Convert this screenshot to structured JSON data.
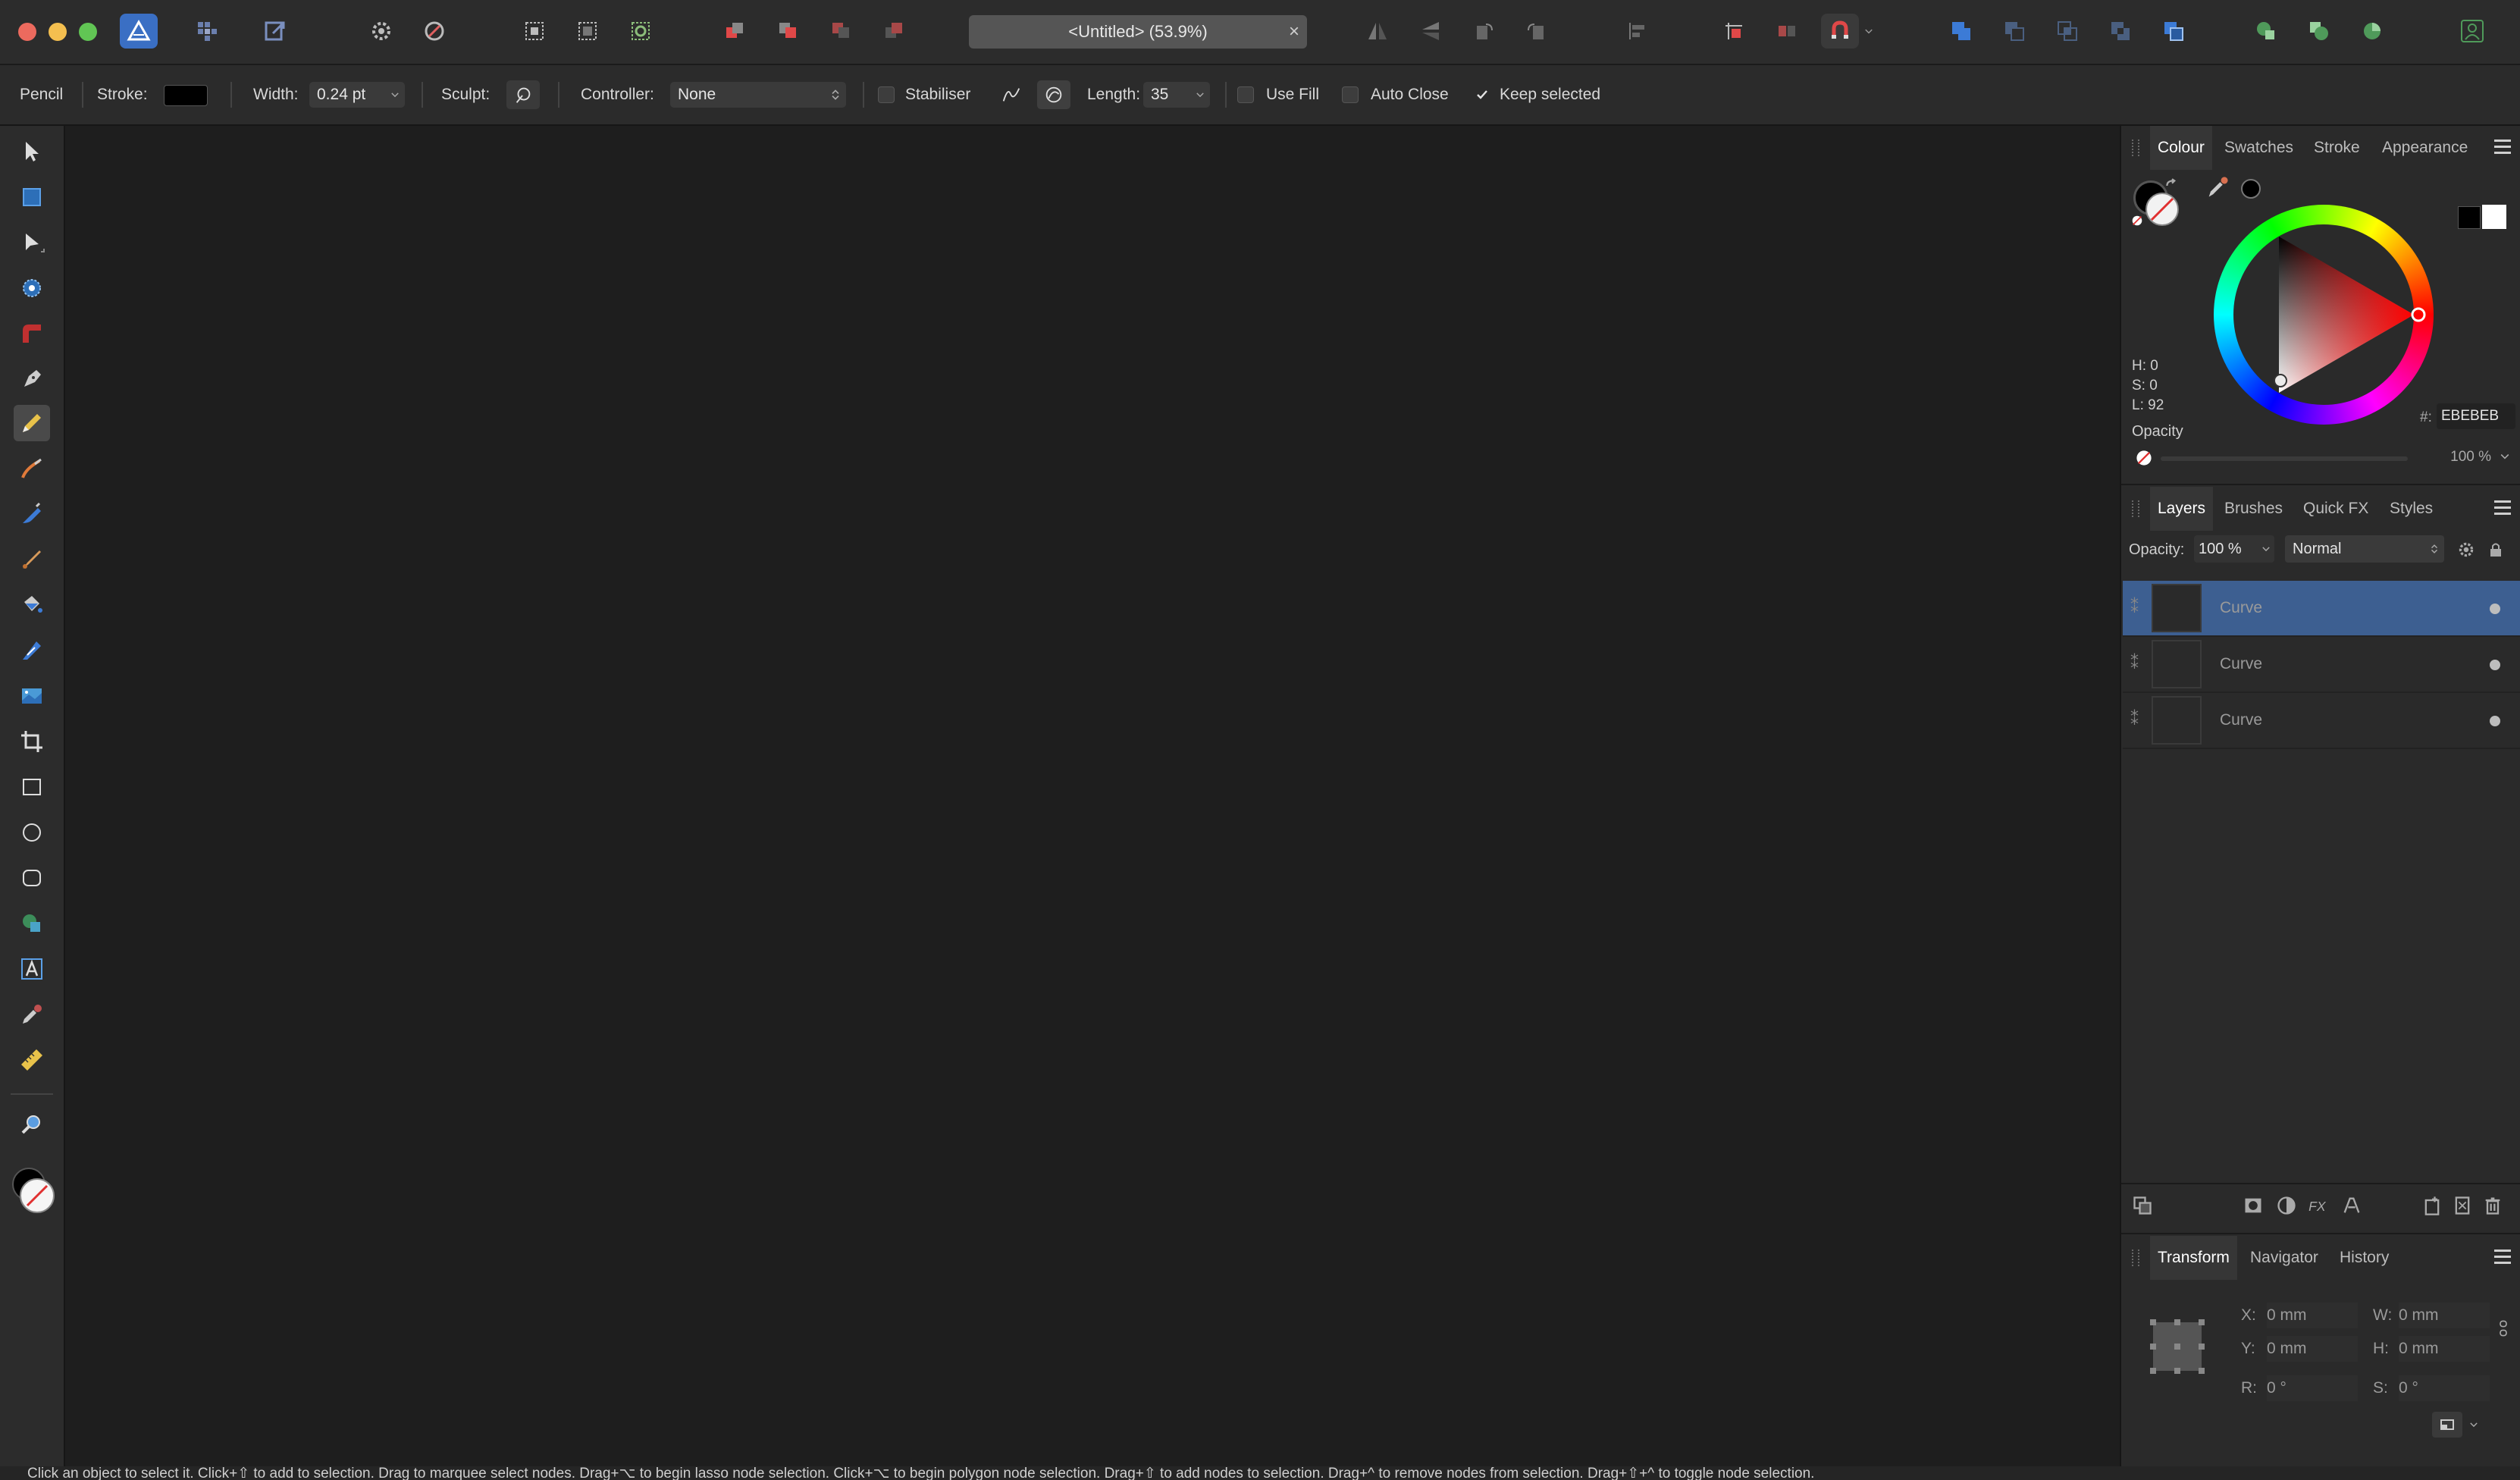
{
  "window": {
    "document_tab": "<Untitled> (53.9%)",
    "close_glyph": "×"
  },
  "context_toolbar": {
    "tool_name": "Pencil",
    "stroke_label": "Stroke:",
    "stroke_color": "#000000",
    "width_label": "Width:",
    "width_value": "0.24 pt",
    "sculpt_label": "Sculpt:",
    "controller_label": "Controller:",
    "controller_value": "None",
    "stabiliser_label": "Stabiliser",
    "length_label": "Length:",
    "length_value": "35",
    "use_fill_label": "Use Fill",
    "auto_close_label": "Auto Close",
    "keep_selected_label": "Keep selected",
    "keep_selected_checked": true
  },
  "colour_panel": {
    "tabs": [
      "Colour",
      "Swatches",
      "Stroke",
      "Appearance"
    ],
    "active_tab": "Colour",
    "h_label": "H: 0",
    "s_label": "S: 0",
    "l_label": "L: 92",
    "hex_prefix": "#:",
    "hex_value": "EBEBEB",
    "opacity_label": "Opacity",
    "opacity_value": "100 %"
  },
  "layers_panel": {
    "tabs": [
      "Layers",
      "Brushes",
      "Quick FX",
      "Styles"
    ],
    "active_tab": "Layers",
    "opacity_label": "Opacity:",
    "opacity_value": "100 %",
    "blend_mode": "Normal",
    "layers": [
      {
        "name": "Curve",
        "selected": true
      },
      {
        "name": "Curve",
        "selected": false
      },
      {
        "name": "Curve",
        "selected": false
      }
    ]
  },
  "transform_panel": {
    "tabs": [
      "Transform",
      "Navigator",
      "History"
    ],
    "active_tab": "Transform",
    "x_label": "X:",
    "x_value": "0 mm",
    "y_label": "Y:",
    "y_value": "0 mm",
    "w_label": "W:",
    "w_value": "0 mm",
    "h_label": "H:",
    "h_value": "0 mm",
    "r_label": "R:",
    "r_value": "0 °",
    "s_label": "S:",
    "s_value": "0 °"
  },
  "status_bar": {
    "text": "Click an object to select it. Click+⇧ to add to selection. Drag to marquee select nodes. Drag+⌥ to begin lasso node selection. Click+⌥ to begin polygon node selection. Drag+⇧ to add nodes to selection. Drag+^ to remove nodes from selection. Drag+⇧+^ to toggle node selection."
  },
  "colors": {
    "accent": "#3d5f91",
    "canvas": "#1e1e1e",
    "panel": "#2a2a2a"
  }
}
